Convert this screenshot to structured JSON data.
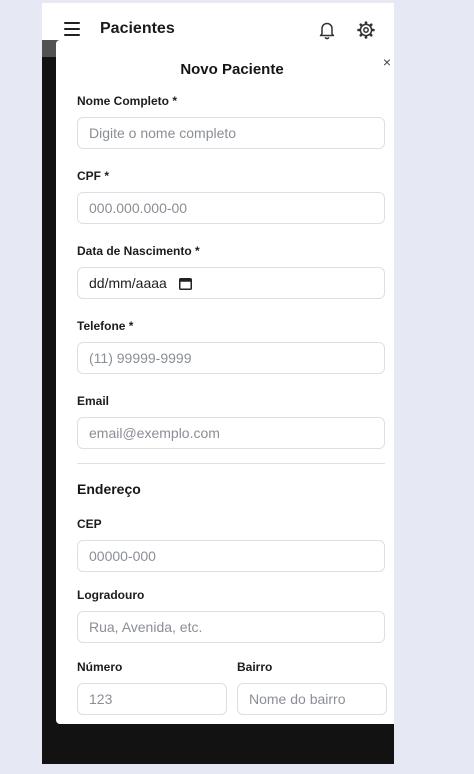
{
  "header": {
    "title": "Pacientes"
  },
  "modal": {
    "title": "Novo Paciente",
    "close_symbol": "×",
    "fields": {
      "nome": {
        "label": "Nome Completo *",
        "placeholder": "Digite o nome completo"
      },
      "cpf": {
        "label": "CPF *",
        "placeholder": "000.000.000-00"
      },
      "nascimento": {
        "label": "Data de Nascimento *",
        "value": "dd/mm/aaaa"
      },
      "telefone": {
        "label": "Telefone *",
        "placeholder": "(11) 99999-9999"
      },
      "email": {
        "label": "Email",
        "placeholder": "email@exemplo.com"
      }
    },
    "endereco": {
      "title": "Endereço",
      "cep": {
        "label": "CEP",
        "placeholder": "00000-000"
      },
      "logradouro": {
        "label": "Logradouro",
        "placeholder": "Rua, Avenida, etc."
      },
      "numero": {
        "label": "Número",
        "placeholder": "123"
      },
      "bairro": {
        "label": "Bairro",
        "placeholder": "Nome do bairro"
      }
    }
  },
  "icons": {
    "menu": "menu-icon",
    "notifications": "bell-icon",
    "settings": "gear-icon",
    "calendar": "calendar-icon",
    "close": "close-icon"
  }
}
